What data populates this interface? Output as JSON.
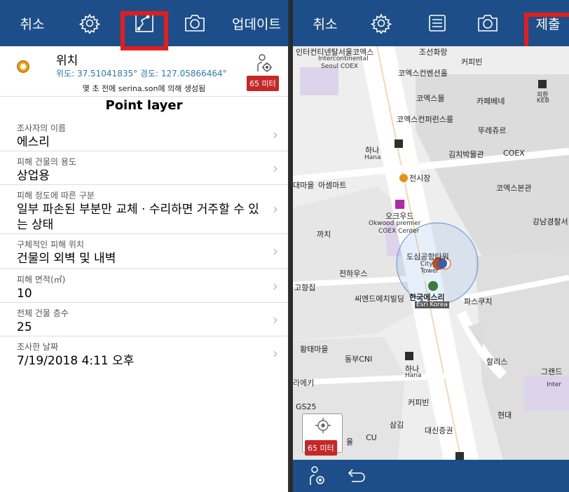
{
  "left": {
    "topbar": {
      "cancel": "취소",
      "update": "업데이트",
      "icons": [
        "gear-icon",
        "edit-geometry-icon",
        "camera-icon"
      ]
    },
    "location": {
      "title": "위치",
      "coords": "위도: 37.51041835° 경도: 127.05866464°",
      "created": "몇 초 전에 serina.son에 의해 생성됨",
      "accuracy": "65 미터"
    },
    "layer_title": "Point layer",
    "fields": [
      {
        "label": "조사자의 이름",
        "value": "에스리"
      },
      {
        "label": "피해 건물의 용도",
        "value": "상업용"
      },
      {
        "label": "피해 정도에 따른 구분",
        "value": "일부 파손된 부분만 교체 · 수리하면 거주할 수 있는 상태"
      },
      {
        "label": "구체적인 피해 위치",
        "value": "건물의 외벽 및 내벽"
      },
      {
        "label": "피해 면적(㎡)",
        "value": "10"
      },
      {
        "label": "전체 건물 층수",
        "value": "25"
      },
      {
        "label": "조사한 날짜",
        "value": "7/19/2018 4:11 오후"
      }
    ]
  },
  "right": {
    "topbar": {
      "cancel": "취소",
      "submit": "제출",
      "icons": [
        "gear-icon",
        "form-list-icon",
        "camera-icon"
      ]
    },
    "map_labels": {
      "intercont": "인터컨티넨탈서울코엑스",
      "intercont_en": "Intercontinental",
      "intercont_en2": "Seoul COEX",
      "josun": "조선화랑",
      "coffeebean1": "커피빈",
      "coex_conv": "코엑스컨벤션홀",
      "coexstore": "코엑스몰",
      "cafebene": "카페베네",
      "hana_keb": "외환",
      "keb": "KEB",
      "coex_conf": "코엑스컨퍼런스룸",
      "tourles": "뚜레쥬르",
      "hana1": "하나",
      "hana1_en": "Hana",
      "kimchi": "김치박물관",
      "coex": "COEX",
      "exhibit": "전시장",
      "village": "대마을",
      "asem": "아셈마트",
      "coex_main": "코엑스본관",
      "okwood": "오크우드",
      "okwood_en": "Okwood premier",
      "okwood_en2": "COEX Center",
      "gangnam_police": "강남경찰서",
      "ggachi": "까치",
      "citytower": "도심공항타워",
      "citytower_en": "City",
      "citytower_en2": "Tower",
      "jeonhauss": "전하우스",
      "gohwang": "고향집",
      "wend": "씨엔드에치빌딩",
      "esri": "한국에스리",
      "esri_en": "Esri Korea",
      "paskuchi": "파스쿠치",
      "hwangtae": "황태마을",
      "dongbu": "동부CNI",
      "hana2": "하나",
      "hana2_en": "Hana",
      "hollys": "할리스",
      "grand": "그랜드",
      "grand_en": "Inter",
      "ramekki": "라메키",
      "coffeebean2": "커피빈",
      "gs25": "GS25",
      "hyundai": "현대",
      "samgim": "삼김",
      "daeshin": "대신증권",
      "yul": "율",
      "cu": "CU"
    },
    "accuracy": "65 미터",
    "bottom_icons": [
      "gps-icon",
      "back-arrow-icon"
    ]
  },
  "colors": {
    "topbar": "#1d4e8a",
    "highlight": "#e31c1c",
    "accuracy_badge": "#c62828",
    "link_blue": "#2a7ab8"
  }
}
